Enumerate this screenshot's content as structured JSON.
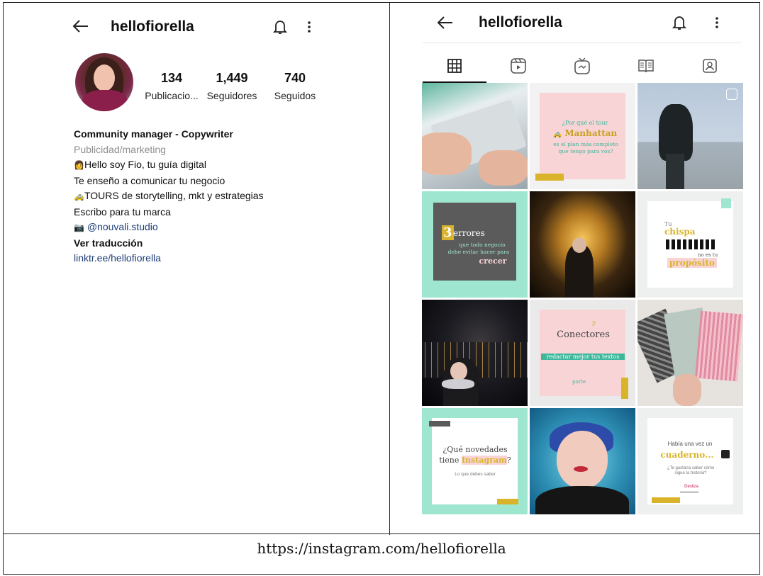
{
  "left": {
    "back_icon": "arrow-left-icon",
    "username": "hellofiorella",
    "bell_icon": "bell-icon",
    "more_icon": "more-vertical-icon",
    "stats": [
      {
        "num": "134",
        "label": "Publicacio..."
      },
      {
        "num": "1,449",
        "label": "Seguidores"
      },
      {
        "num": "740",
        "label": "Seguidos"
      }
    ],
    "bio": {
      "title": "Community manager - Copywriter",
      "category": "Publicidad/marketing",
      "line1": "Hello soy Fio, tu guía digital",
      "line2": "Te enseño a comunicar tu negocio",
      "line3": "TOURS de storytelling, mkt y estrategias",
      "line4": "Escribo para tu marca",
      "line5": "@nouvali.studio",
      "translate": "Ver traducción",
      "link": "linktr.ee/hellofiorella"
    }
  },
  "right": {
    "username": "hellofiorella",
    "tabs": [
      {
        "icon": "grid-icon",
        "active": true
      },
      {
        "icon": "reels-icon",
        "active": false
      },
      {
        "icon": "igtv-icon",
        "active": false
      },
      {
        "icon": "guides-icon",
        "active": false
      },
      {
        "icon": "tagged-icon",
        "active": false
      }
    ],
    "posts": {
      "p2_small": "¿Por qué el tour",
      "p2_big": "Manhattan",
      "p2_tail1": "es el plan más completo",
      "p2_tail2": "que tengo para vos?",
      "p4_num": "3",
      "p4_big": "errores",
      "p4_l1": "que todo negocio",
      "p4_l2": "debe evitar hacer para",
      "p4_l3": "crecer",
      "p6_tu": "Tu",
      "p6_chispa": "chispa",
      "p6_noes": "no es tu",
      "p6_prop": "propósito",
      "p8_title": "Conectores",
      "p8_sub": "redactar mejor tus textos",
      "p8_p": "p",
      "p8_parte": "porte",
      "p10_l1": "¿Qué novedades",
      "p10_l2a": "tiene",
      "p10_l2b": "Instagram",
      "p10_l2c": "?",
      "p10_sub": "Lo que debes saber",
      "p12_l1": "Había una vez un",
      "p12_big": "cuaderno...",
      "p12_q1": "¿Te gustaría saber cómo",
      "p12_q2": "sigue la historia?",
      "p12_cta": "Desliza"
    }
  },
  "caption": "https://instagram.com/hellofiorella",
  "colors": {
    "mint": "#9fe6d0",
    "pink": "#f8d4d6",
    "gold": "#d9b42a",
    "teal": "#3bb89c",
    "dark_gray": "#5b5b5b"
  }
}
